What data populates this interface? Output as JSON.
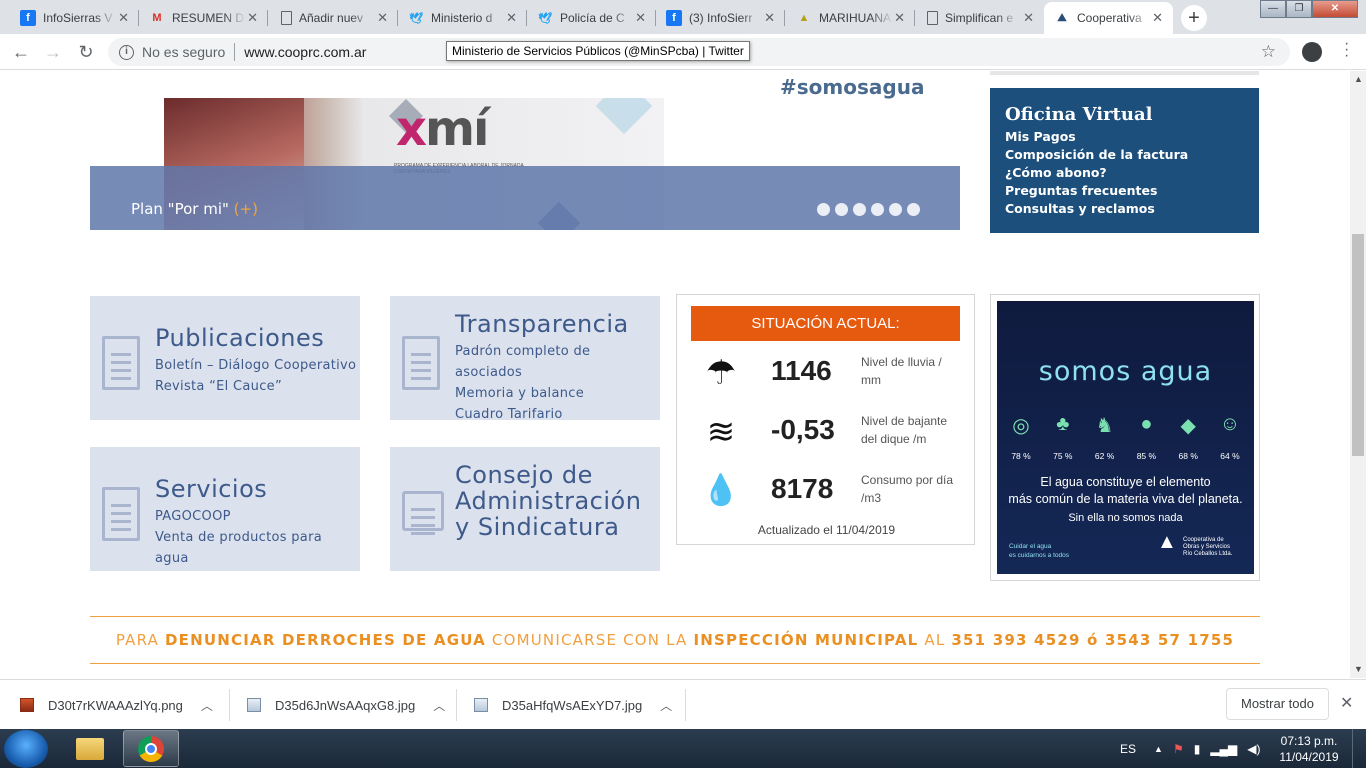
{
  "browser": {
    "tabs": [
      {
        "title": "InfoSierras V",
        "icon": "facebook-icon"
      },
      {
        "title": "RESUMEN D",
        "icon": "gmail-icon"
      },
      {
        "title": "Añadir nuev",
        "icon": "document-icon"
      },
      {
        "title": "Ministerio d",
        "icon": "twitter-icon"
      },
      {
        "title": "Policía de C",
        "icon": "twitter-icon"
      },
      {
        "title": "(3) InfoSierr",
        "icon": "facebook-icon"
      },
      {
        "title": "MARIHUANA",
        "icon": "leaf-icon"
      },
      {
        "title": "Simplifican e",
        "icon": "document-icon"
      },
      {
        "title": "Cooperativa",
        "icon": "coop-icon",
        "active": true
      }
    ],
    "security_label": "No es seguro",
    "url": "www.cooprc.com.ar",
    "tooltip": "Ministerio de Servicios Públicos (@MinSPcba) | Twitter"
  },
  "slider": {
    "hashtag": "#somosagua",
    "logo_x": "x",
    "logo_mi": "mí",
    "logo_sub": "PROGRAMA DE EXPERIENCIA LABORAL DE JORNADA CORTA PARA MUJERES",
    "caption": "Plan \"Por mi\"",
    "caption_plus": "(+)",
    "dot_count": 6
  },
  "oficina": {
    "title": "Oficina Virtual",
    "links": [
      "Mis Pagos",
      "Composición de la factura",
      "¿Cómo abono?",
      "Preguntas frecuentes",
      "Consultas y reclamos"
    ]
  },
  "cards": {
    "publicaciones": {
      "title": "Publicaciones",
      "links": [
        "Boletín – Diálogo Cooperativo",
        "Revista “El Cauce”"
      ]
    },
    "transparencia": {
      "title": "Transparencia",
      "links": [
        "Padrón completo de asociados",
        "Memoria y balance",
        "Cuadro Tarifario"
      ]
    },
    "servicios": {
      "title": "Servicios",
      "links": [
        "PAGOCOOP",
        "Venta de productos para agua"
      ]
    },
    "consejo": {
      "title_lines": [
        "Consejo de",
        "Administración",
        "y Sindicatura"
      ]
    }
  },
  "situacion": {
    "header": "SITUACIÓN ACTUAL:",
    "rows": [
      {
        "icon": "rain-cloud-icon",
        "value": "1146",
        "label": "Nivel de lluvia / mm"
      },
      {
        "icon": "waves-icon",
        "value": "-0,53",
        "label": "Nivel de bajante del dique /m"
      },
      {
        "icon": "drop-icon",
        "value": "8178",
        "label": "Consumo por día /m3"
      }
    ],
    "updated": "Actualizado el 11/04/2019"
  },
  "poster": {
    "headline": "somos agua",
    "percents": [
      "78 %",
      "75 %",
      "62 %",
      "85 %",
      "68 %",
      "64 %"
    ],
    "line1": "El agua constituye el elemento",
    "line2": "más común de la materia viva del planeta.",
    "line3": "Sin ella no somos nada",
    "foot1": "Cuidar el agua",
    "foot2": "es cuidarnos a todos",
    "logo1": "Cooperativa de",
    "logo2": "Obras y Servicios",
    "logo3": "Río Ceballos Ltda."
  },
  "banner": {
    "p1": "PARA ",
    "b1": "DENUNCIAR DERROCHES DE AGUA",
    "p2": " COMUNICARSE CON LA ",
    "b2": "INSPECCIÓN MUNICIPAL",
    "p3": " AL ",
    "b3": "351 393 4529 ó 3543 57 1755"
  },
  "downloads": {
    "files": [
      "D30t7rKWAAAzlYq.png",
      "D35d6JnWsAAqxG8.jpg",
      "D35aHfqWsAExYD7.jpg"
    ],
    "show_all": "Mostrar todo"
  },
  "taskbar": {
    "lang": "ES",
    "time": "07:13 p.m.",
    "date": "11/04/2019"
  },
  "colors": {
    "accent": "#e65a10",
    "brand_blue": "#1c4f7c",
    "card_bg": "#dce1ee",
    "banner": "#f0a040"
  }
}
